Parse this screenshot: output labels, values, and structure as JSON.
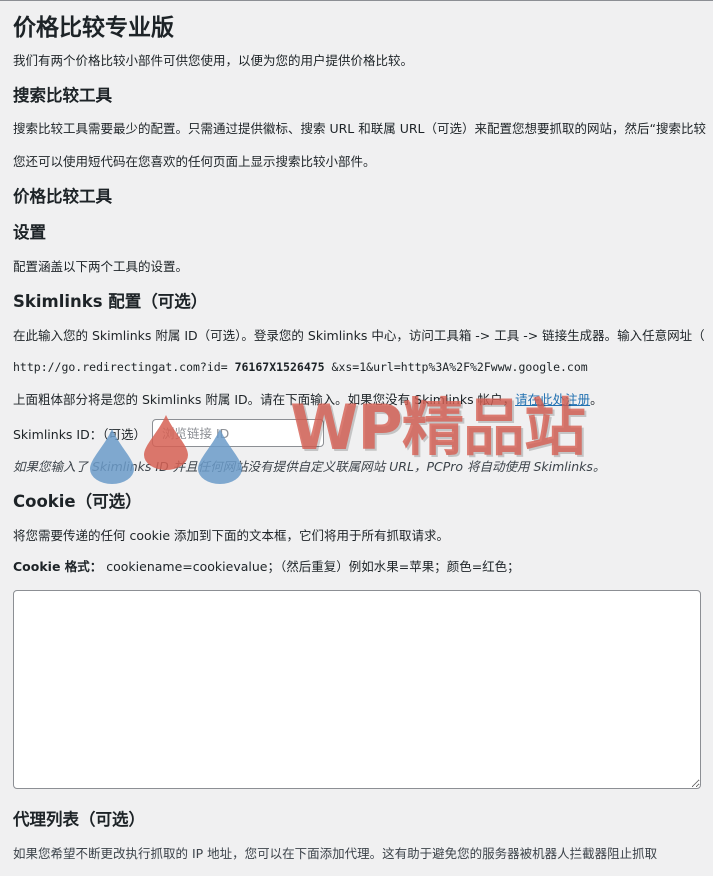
{
  "page": {
    "title": "价格比较专业版",
    "intro": "我们有两个价格比较小部件可供您使用，以便为您的用户提供价格比较。"
  },
  "search_tool": {
    "heading": "搜索比较工具",
    "desc": "搜索比较工具需要最少的配置。只需通过提供徽标、搜索 URL 和联属 URL（可选）来配置您想要抓取的网站，然后“搜索比较",
    "shortcode_note": "您还可以使用短代码在您喜欢的任何页面上显示搜索比较小部件。"
  },
  "price_tool": {
    "heading": "价格比较工具"
  },
  "settings": {
    "heading": "设置",
    "desc": "配置涵盖以下两个工具的设置。"
  },
  "skimlinks": {
    "heading": "Skimlinks 配置（可选）",
    "desc": "在此输入您的 Skimlinks 附属 ID（可选）。登录您的 Skimlinks 中心，访问工具箱 -> 工具 -> 链接生成器。输入任意网址（",
    "url_prefix": "http://go.redirectingat.com?id=",
    "url_id": "76167X1526475",
    "url_suffix": "&xs=1&url=http%3A%2F%2Fwww.google.com",
    "bold_note_before": "上面粗体部分将是您的 Skimlinks 附属 ID。请在下面输入。如果您没有 Skimlinks 帐户，",
    "register_link": "请在此处注册",
    "bold_note_after": "。",
    "id_label": "Skimlinks ID：（可选）",
    "id_placeholder": "浏览链接 ID",
    "id_value": "",
    "fallback_note": "如果您输入了 Skimlinks ID 并且任何网站没有提供自定义联属网站 URL，PCPro 将自动使用 Skimlinks。"
  },
  "cookie": {
    "heading": "Cookie（可选）",
    "desc": "将您需要传递的任何 cookie 添加到下面的文本框，它们将用于所有抓取请求。",
    "format_label": "Cookie 格式：",
    "format_value": "cookiename=cookievalue；（然后重复）例如水果=苹果；颜色=红色；",
    "textarea_value": ""
  },
  "proxy": {
    "heading": "代理列表（可选）",
    "desc_partial": "如果您希望不断更改执行抓取的 IP 地址，您可以在下面添加代理。这有助于避免您的服务器被机器人拦截器阻止抓取"
  },
  "watermark": {
    "text": "WP精品站",
    "colors": {
      "red": "#d66054",
      "blue": "#6b9bc9"
    }
  }
}
